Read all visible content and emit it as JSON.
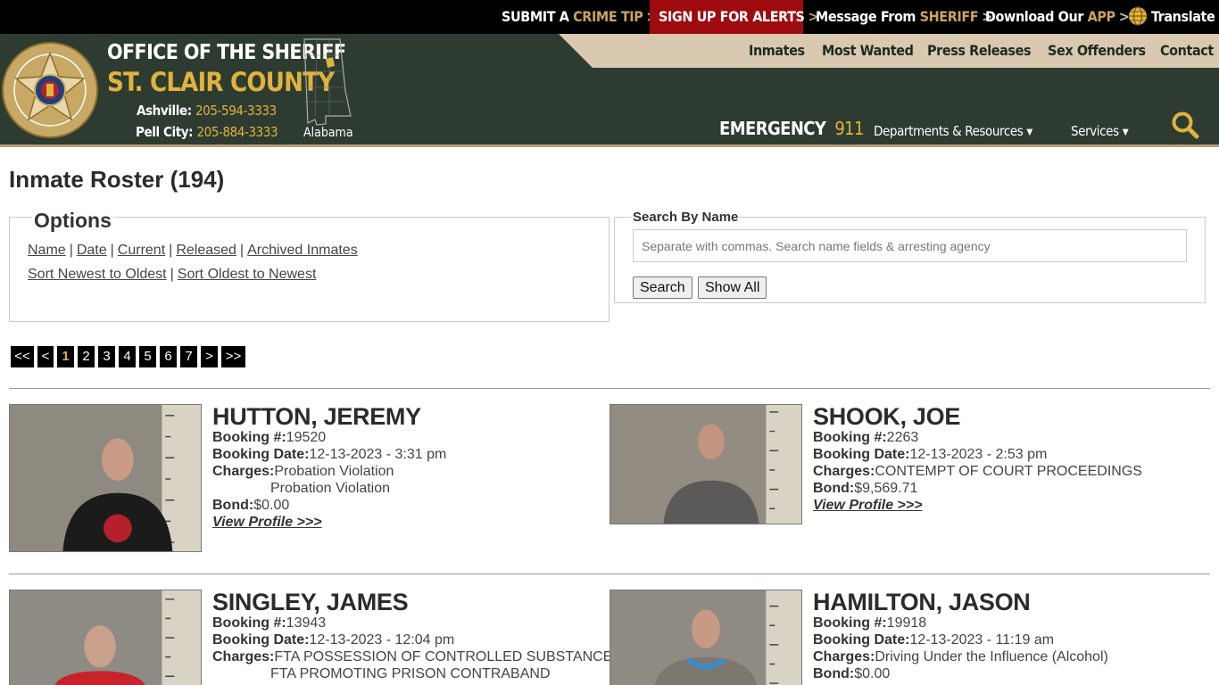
{
  "topbar": {
    "crime_tip": {
      "a": "SUBMIT A",
      "b": "CRIME TIP"
    },
    "alerts": "SIGN UP FOR ALERTS",
    "sheriff_msg": {
      "a": "Message From",
      "b": "SHERIFF"
    },
    "app": {
      "a": "Download Our",
      "b": "APP"
    },
    "translate": "Translate",
    "chevron": ">"
  },
  "header": {
    "office": "OFFICE OF THE SHERIFF",
    "county": "ST. CLAIR COUNTY",
    "phones": [
      {
        "city": "Ashville:",
        "number": "205-594-3333"
      },
      {
        "city": "Pell City:",
        "number": "205-884-3333"
      }
    ],
    "state": "Alabama",
    "nav": [
      "Inmates",
      "Most Wanted",
      "Press Releases",
      "Sex Offenders",
      "Contact"
    ],
    "emergency": {
      "label": "EMERGENCY",
      "number": "911"
    },
    "subnav": [
      "Departments & Resources",
      "Services"
    ],
    "colors": {
      "dark_green": "#2e3b30",
      "gold": "#e0b33e",
      "tan": "#d8c9b0",
      "alert_red": "#9e0b0f"
    }
  },
  "page": {
    "title": "Inmate Roster (194)",
    "options": {
      "legend": "Options",
      "filters": [
        "Name",
        "Date",
        "Current",
        "Released",
        "Archived Inmates"
      ],
      "sorts": [
        "Sort Newest to Oldest",
        "Sort Oldest to Newest"
      ],
      "sep": "|"
    },
    "search": {
      "legend": "Search By Name",
      "placeholder": "Separate with commas. Search name fields & arresting agency",
      "search_btn": "Search",
      "show_all_btn": "Show All"
    },
    "pager": [
      "<<",
      "<",
      "1",
      "2",
      "3",
      "4",
      "5",
      "6",
      "7",
      ">",
      ">>"
    ],
    "pager_active": "1"
  },
  "labels": {
    "booking_no": "Booking #:",
    "booking_date": "Booking Date:",
    "charges": "Charges:",
    "bond": "Bond:",
    "view_profile": "View Profile >>>"
  },
  "inmates": [
    {
      "name": "HUTTON, JEREMY",
      "booking_no": "19520",
      "booking_date": "12-13-2023 - 3:31 pm",
      "charges": [
        "Probation Violation",
        "Probation Violation"
      ],
      "bond": "$0.00"
    },
    {
      "name": "SHOOK, JOE",
      "booking_no": "2263",
      "booking_date": "12-13-2023 - 2:53 pm",
      "charges": [
        "CONTEMPT OF COURT PROCEEDINGS"
      ],
      "bond": "$9,569.71"
    },
    {
      "name": "SINGLEY, JAMES",
      "booking_no": "13943",
      "booking_date": "12-13-2023 - 12:04 pm",
      "charges": [
        "FTA POSSESSION OF CONTROLLED SUBSTANCE",
        "FTA PROMOTING PRISON CONTRABAND"
      ],
      "bond": ""
    },
    {
      "name": "HAMILTON, JASON",
      "booking_no": "19918",
      "booking_date": "12-13-2023 - 11:19 am",
      "charges": [
        "Driving Under the Influence (Alcohol)"
      ],
      "bond": "$0.00"
    }
  ]
}
